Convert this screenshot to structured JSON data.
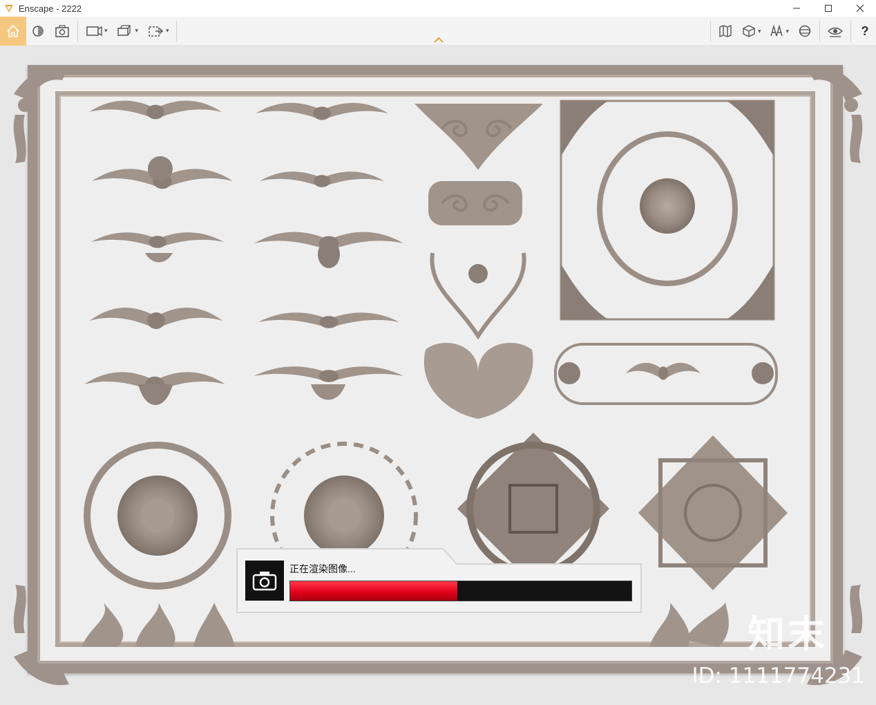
{
  "window": {
    "title": "Enscape - 2222",
    "controls": [
      "minimize-icon",
      "maximize-icon",
      "close-icon"
    ]
  },
  "toolbar": {
    "left_icons": [
      "home-icon",
      "render-settings-icon",
      "capture-icon",
      "views-icon",
      "assets-icon",
      "export-icon"
    ],
    "right_icons": [
      "map-icon",
      "cube-icon",
      "library-icon",
      "vr-headset-icon",
      "visibility-icon"
    ],
    "help_label": "?"
  },
  "render_popup": {
    "status_text": "正在渲染图像...",
    "progress": 0.49,
    "icon": "camera-icon",
    "bar_color": "#e3001a"
  },
  "watermark": {
    "brand": "知末",
    "id_text": "ID: 1111774231"
  },
  "colors": {
    "home_accent": "#f6c87f",
    "frame": "#9f928a",
    "ornament": "#8f837b",
    "caret_accent": "#e8a23c"
  }
}
